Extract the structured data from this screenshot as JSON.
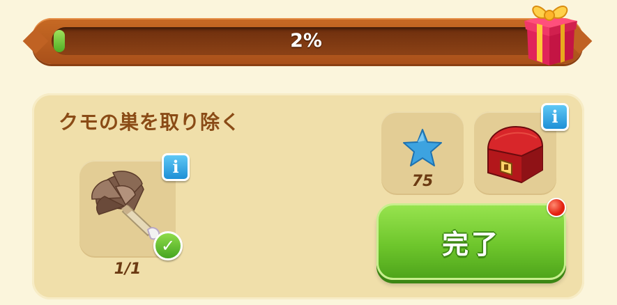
{
  "progress": {
    "value": 0.02,
    "label": "2%"
  },
  "task": {
    "title": "クモの巣を取り除く",
    "item": {
      "icon": "feather-duster-icon",
      "count": "1/1",
      "completed": true
    }
  },
  "rewards": [
    {
      "icon": "blue-star-icon",
      "amount": "75"
    },
    {
      "icon": "red-treasure-chest-icon"
    }
  ],
  "complete_button": {
    "label": "完了"
  },
  "colors": {
    "accent_green": "#6ec62c",
    "bar_orange": "#c06223",
    "info_blue": "#1e8fd6"
  }
}
